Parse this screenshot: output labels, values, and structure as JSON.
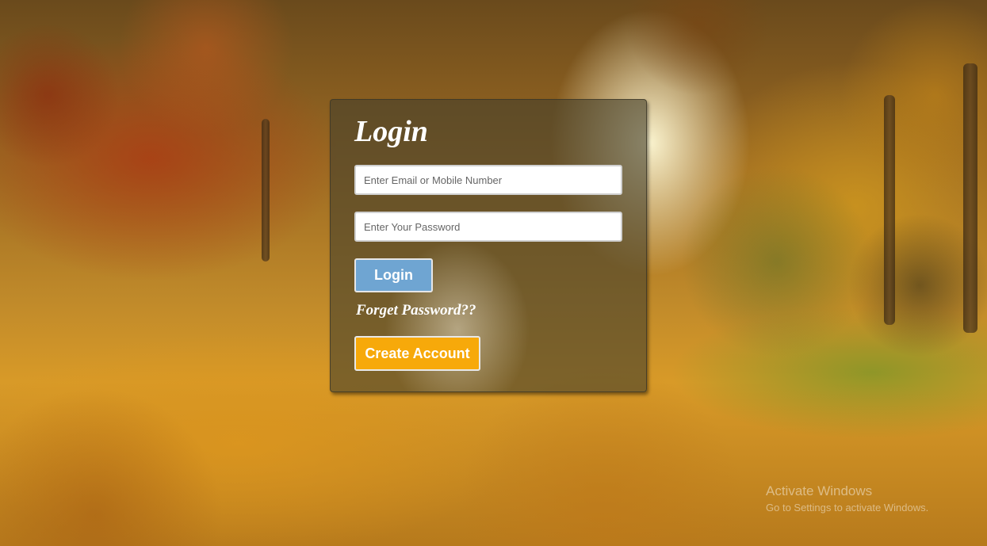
{
  "login": {
    "title": "Login",
    "email_placeholder": "Enter Email or Mobile Number",
    "email_value": "",
    "password_placeholder": "Enter Your Password",
    "password_value": "",
    "login_button": "Login",
    "forget_link": "Forget Password??",
    "create_account_button": "Create Account"
  },
  "watermark": {
    "title": "Activate Windows",
    "subtitle": "Go to Settings to activate Windows."
  },
  "colors": {
    "login_button": "#6fa5d2",
    "create_account_button": "#f7a90a",
    "panel_overlay": "#46402c"
  }
}
